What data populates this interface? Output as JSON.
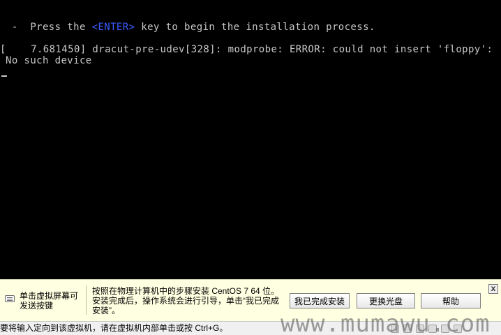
{
  "console": {
    "line_1_before": " -  Press the ",
    "line_1_key": "<ENTER>",
    "line_1_after": " key to begin the installation process.",
    "line_2": "[    7.681450] dracut-pre-udev[328]: modprobe: ERROR: could not insert 'floppy':",
    "line_3": "No such device"
  },
  "hint_bar": {
    "keyboard_hint": "单击虚拟屏幕可发送按键",
    "message_line_1": "按照在物理计算机中的步骤安装 CentOS 7 64 位。",
    "message_line_2": "安装完成后，操作系统会进行引导，单击“我已完成",
    "message_line_3": "安装”。",
    "done_button": "我已完成安装",
    "change_disk_button": "更换光盘",
    "help_button": "帮助",
    "close_glyph": "x"
  },
  "status_bar": {
    "text": "要将输入定向到该虚拟机，请在虚拟机内部单击或按 Ctrl+G。"
  },
  "watermark": {
    "text": "www.mumawu.com"
  },
  "colors": {
    "console_background": "#000000",
    "console_text": "#c8c8c8",
    "enter_key_text": "#3c5cff",
    "hint_background": "#ffffe1",
    "status_background": "#f0f0f0"
  },
  "icons": {
    "keyboard": "keyboard-icon",
    "close": "close-icon",
    "status_tools": "device-icons"
  }
}
